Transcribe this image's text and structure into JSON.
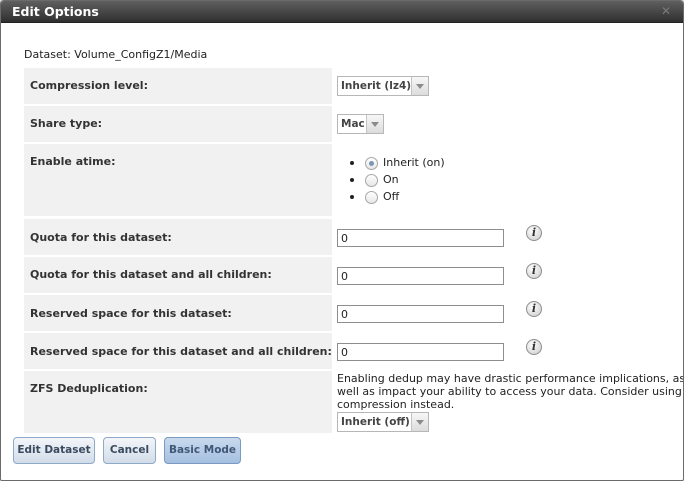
{
  "dialog": {
    "title": "Edit Options",
    "close_glyph": "✕"
  },
  "dataset_line": "Dataset: Volume_ConfigZ1/Media",
  "compression": {
    "label": "Compression level:",
    "value": "Inherit (lz4)"
  },
  "share_type": {
    "label": "Share type:",
    "value": "Mac"
  },
  "atime": {
    "label": "Enable atime:",
    "options": [
      "Inherit (on)",
      "On",
      "Off"
    ],
    "selected": "Inherit (on)"
  },
  "quota": {
    "label": "Quota for this dataset:",
    "value": "0"
  },
  "quota_children": {
    "label": "Quota for this dataset and all children:",
    "value": "0"
  },
  "reserved": {
    "label": "Reserved space for this dataset:",
    "value": "0"
  },
  "reserved_children": {
    "label": "Reserved space for this dataset and all children:",
    "value": "0"
  },
  "dedup": {
    "label": "ZFS Deduplication:",
    "note": "Enabling dedup may have drastic performance implications, as well as impact your ability to access your data. Consider using compression instead.",
    "value": "Inherit (off)"
  },
  "info_glyph": "i",
  "buttons": {
    "edit": "Edit Dataset",
    "cancel": "Cancel",
    "basic": "Basic Mode"
  },
  "colors": {
    "titlebar": "#3d3d3d",
    "label_bg": "#f1f1f1",
    "button_border": "#8fa9c9"
  }
}
